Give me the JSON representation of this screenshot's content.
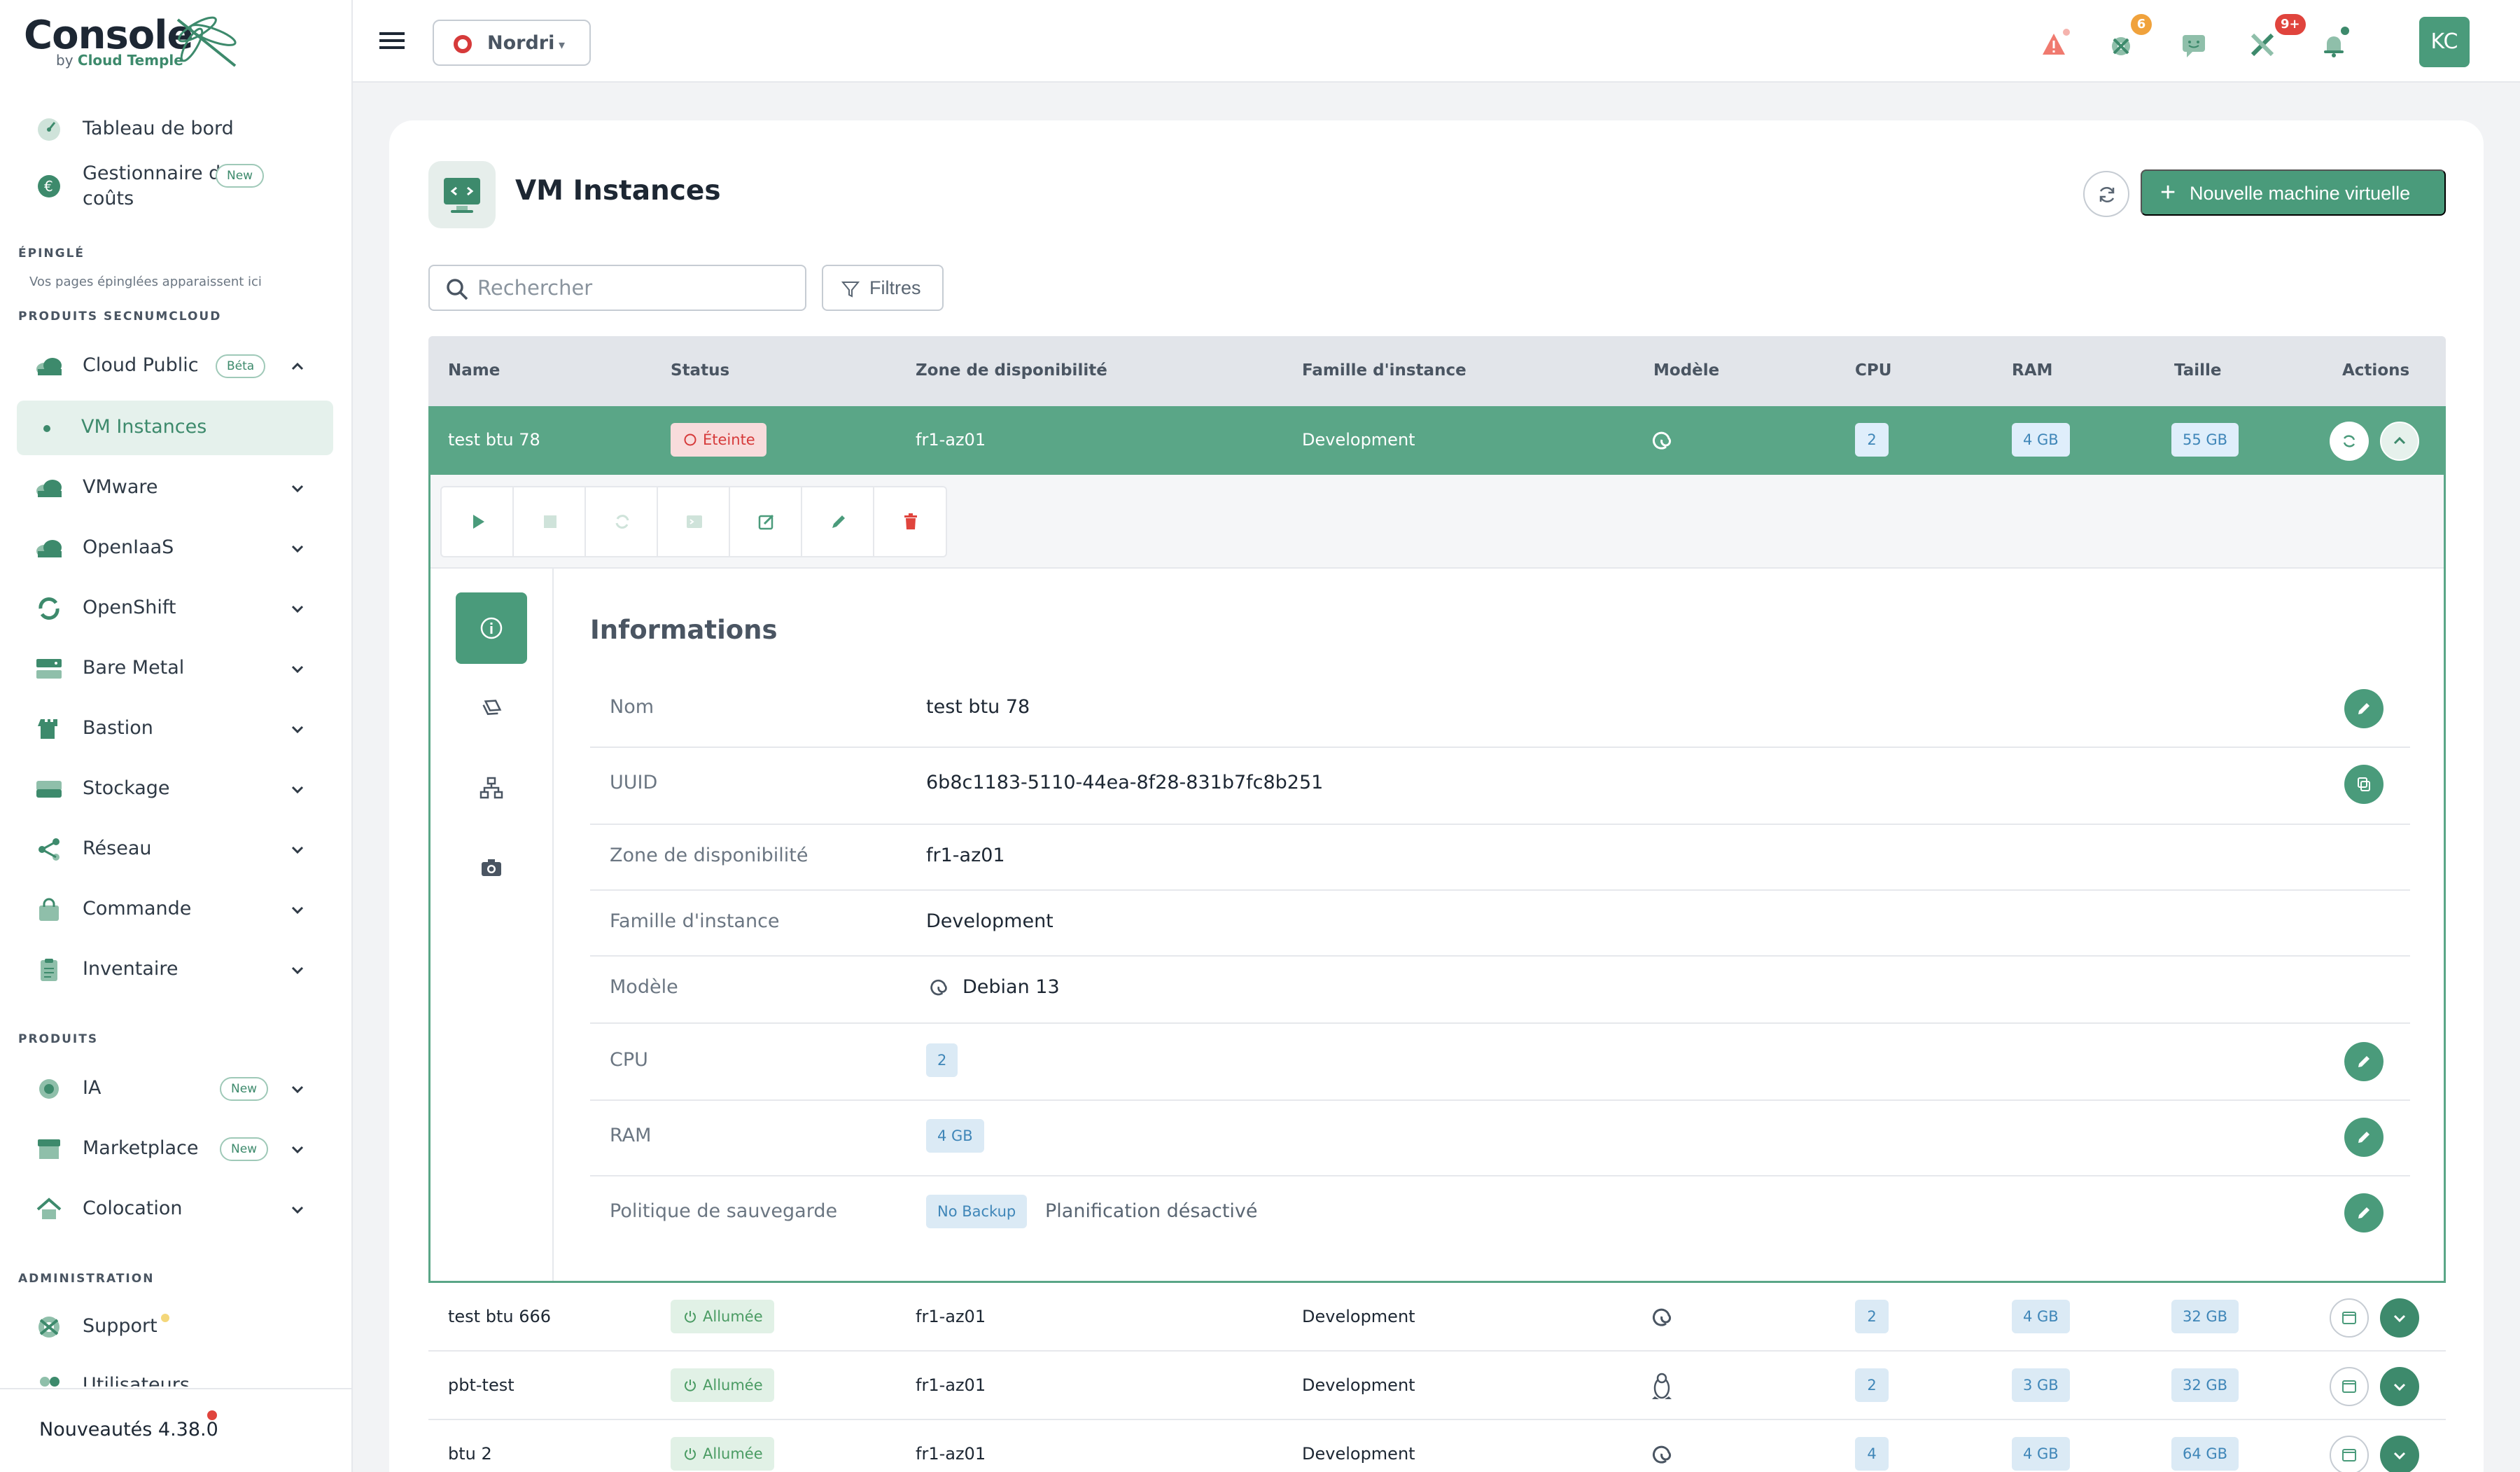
{
  "brand": {
    "name": "Console",
    "sub_prefix": "by ",
    "sub_company": "Cloud Temple"
  },
  "sidebar": {
    "dashboard": "Tableau de bord",
    "cost_manager": "Gestionnaire des coûts",
    "new_badge": "New",
    "beta_badge": "Béta",
    "pinned_section": "ÉPINGLÉ",
    "pinned_hint": "Vos pages épinglées apparaissent ici",
    "secnum_section": "PRODUITS SECNUMCLOUD",
    "items": {
      "cloud_public": "Cloud Public",
      "vm_instances": "VM Instances",
      "vmware": "VMware",
      "openiaas": "OpenIaaS",
      "openshift": "OpenShift",
      "bare_metal": "Bare Metal",
      "bastion": "Bastion",
      "stockage": "Stockage",
      "reseau": "Réseau",
      "commande": "Commande",
      "inventaire": "Inventaire"
    },
    "products_section": "PRODUITS",
    "products": {
      "ia": "IA",
      "marketplace": "Marketplace",
      "colocation": "Colocation"
    },
    "admin_section": "ADMINISTRATION",
    "admin": {
      "support": "Support",
      "users": "Utilisateurs"
    },
    "version": "Nouveautés 4.38.0"
  },
  "topbar": {
    "org": "Nordri",
    "badges": {
      "incidents": "6",
      "services": "9+"
    },
    "avatar": "KC",
    "colors": {
      "accent": "#4a9b7b",
      "alert": "#e0443d",
      "warning": "#f0a23c"
    }
  },
  "page": {
    "title": "VM Instances",
    "new_vm_button": "Nouvelle machine virtuelle",
    "search_placeholder": "Rechercher",
    "filters_button": "Filtres"
  },
  "table": {
    "columns": {
      "name": "Name",
      "status": "Status",
      "zone": "Zone de disponibilité",
      "family": "Famille d'instance",
      "model": "Modèle",
      "cpu": "CPU",
      "ram": "RAM",
      "size": "Taille",
      "actions": "Actions"
    },
    "rows": [
      {
        "name": "test btu 78",
        "status": "Éteinte",
        "zone": "fr1-az01",
        "family": "Development",
        "os_icon": "debian-icon",
        "cpu": "2",
        "ram": "4 GB",
        "size": "55 GB"
      },
      {
        "name": "test btu 666",
        "status": "Allumée",
        "zone": "fr1-az01",
        "family": "Development",
        "os_icon": "debian-icon",
        "cpu": "2",
        "ram": "4 GB",
        "size": "32 GB"
      },
      {
        "name": "pbt-test",
        "status": "Allumée",
        "zone": "fr1-az01",
        "family": "Development",
        "os_icon": "linux-icon",
        "cpu": "2",
        "ram": "3 GB",
        "size": "32 GB"
      },
      {
        "name": "btu 2",
        "status": "Allumée",
        "zone": "fr1-az01",
        "family": "Development",
        "os_icon": "debian-icon",
        "cpu": "4",
        "ram": "4 GB",
        "size": "64 GB"
      }
    ]
  },
  "details": {
    "title": "Informations",
    "fields": {
      "nom": {
        "label": "Nom",
        "value": "test btu 78"
      },
      "uuid": {
        "label": "UUID",
        "value": "6b8c1183-5110-44ea-8f28-831b7fc8b251"
      },
      "zone": {
        "label": "Zone de disponibilité",
        "value": "fr1-az01"
      },
      "family": {
        "label": "Famille d'instance",
        "value": "Development"
      },
      "model": {
        "label": "Modèle",
        "value": "Debian 13"
      },
      "cpu": {
        "label": "CPU",
        "value": "2"
      },
      "ram": {
        "label": "RAM",
        "value": "4 GB"
      },
      "backup": {
        "label": "Politique de sauvegarde",
        "value": "No Backup",
        "extra": "Planification désactivé"
      }
    }
  }
}
